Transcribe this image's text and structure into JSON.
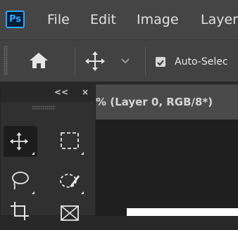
{
  "app": {
    "logo_text": "Ps"
  },
  "menu": {
    "items": [
      "File",
      "Edit",
      "Image",
      "Layer"
    ]
  },
  "options_bar": {
    "home_icon": "home-icon",
    "move_icon": "move-icon",
    "dropdown_icon": "chevron-down-icon",
    "auto_select_label": "Auto-Selec",
    "auto_select_checked": true
  },
  "document": {
    "tab_label": "% (Layer 0, RGB/8*)"
  },
  "tools_panel": {
    "collapse_label": "<<",
    "close_label": "×",
    "tools": [
      {
        "name": "move-tool",
        "icon": "move-icon",
        "active": true
      },
      {
        "name": "marquee-tool",
        "icon": "rect-marquee-icon",
        "active": false
      },
      {
        "name": "lasso-tool",
        "icon": "lasso-icon",
        "active": false
      },
      {
        "name": "quick-select-tool",
        "icon": "quick-select-icon",
        "active": false
      },
      {
        "name": "crop-tool",
        "icon": "crop-icon",
        "active": false
      },
      {
        "name": "frame-tool",
        "icon": "frame-icon",
        "active": false
      }
    ]
  },
  "colors": {
    "menubar_bg": "#454545",
    "options_bg": "#424242",
    "panel_bg": "#303030",
    "ps_blue": "#31a8ff",
    "text": "#e0e0e0"
  }
}
